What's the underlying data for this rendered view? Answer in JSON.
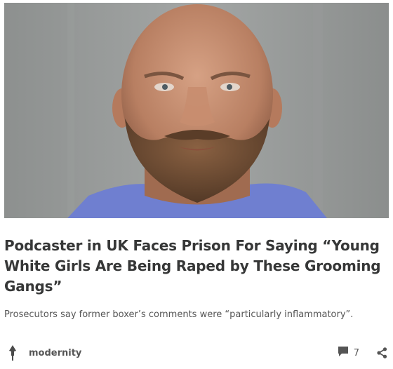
{
  "post": {
    "title": "Podcaster in UK Faces Prison For Saying “Young White Girls Are Being Raped by These Grooming Gangs”",
    "subtitle": "Prosecutors say former boxer’s comments were “particularly inflammatory”.",
    "author": "modernity",
    "comment_count": "7"
  },
  "icons": {
    "author_avatar": "spear-icon",
    "comments": "comment-bubble-icon",
    "share": "share-icon"
  },
  "colors": {
    "text_primary": "#363737",
    "text_secondary": "#555555"
  }
}
